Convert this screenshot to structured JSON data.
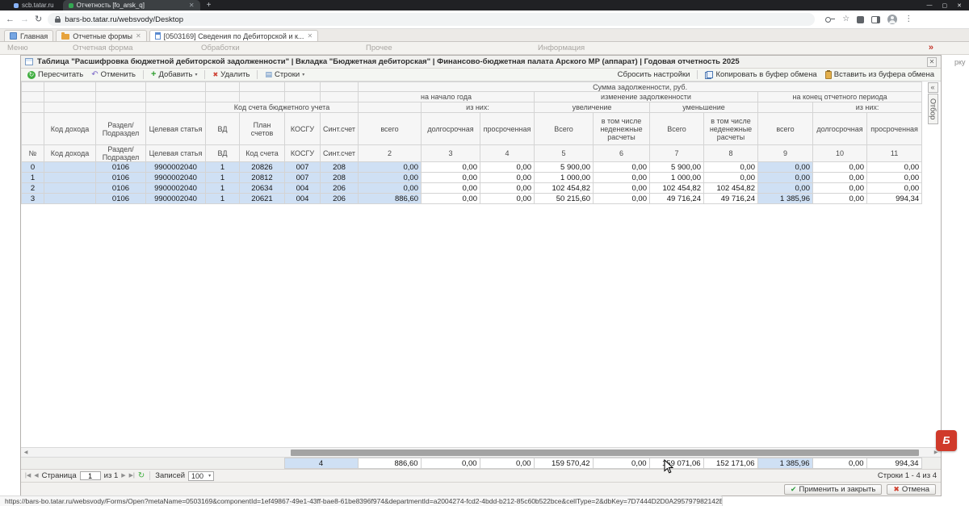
{
  "browser": {
    "tab1": "scb.tatar.ru",
    "tab2": "Отчетность [fo_arsk_q]",
    "url": "bars-bo.tatar.ru/websvody/Desktop",
    "status_url": "https://bars-bo.tatar.ru/websvody/Forms/Open?metaName=0503169&componentId=1ef49867-49e1-43ff-bae8-61be8396f974&departmentId=a2004274-fcd2-4bdd-b212-85c60b522bce&cellType=2&dbKey=7D7444D2D0A295797982142E24DCDAB3492A2DE32AD203F91DA73AD1F29AE97&actualDate=#"
  },
  "app_tabs": [
    {
      "label": "Главная"
    },
    {
      "label": "Отчетные формы"
    },
    {
      "label": "[0503169] Сведения по Дебиторской и к..."
    }
  ],
  "menu": {
    "items": [
      "Меню",
      "Отчетная форма",
      "Обработки",
      "Прочее",
      "Информация"
    ]
  },
  "artifact": "рку",
  "panel": {
    "title": "Таблица \"Расшифровка бюджетной дебиторской задолженности\" | Вкладка \"Бюджетная дебиторская\" | Финансово-бюджетная палата Арского МР (аппарат) | Годовая отчетность 2025"
  },
  "toolbar": {
    "recalc": "Пересчитать",
    "undo": "Отменить",
    "add": "Добавить",
    "delete": "Удалить",
    "rows": "Строки",
    "reset": "Сбросить настройки",
    "copy": "Копировать в буфер обмена",
    "paste": "Вставить из буфера обмена"
  },
  "filter_tab": "Отбор",
  "table": {
    "header": {
      "sum": "Сумма задолженности, руб.",
      "begin": "на начало года",
      "change": "изменение задолженности",
      "end": "на конец отчетного периода",
      "acct": "Код счета бюджетного учета",
      "ofthem": "из них:",
      "inc": "увеличение",
      "dec": "уменьшение",
      "income": "Код дохода",
      "section": "Раздел/ Подраздел",
      "target": "Целевая статья",
      "vd": "ВД",
      "plan": "План счетов",
      "kosgu": "КОСГУ",
      "synt": "Синт.счет",
      "total_l": "всего",
      "long": "долгосрочная",
      "overdue": "просроченная",
      "total_u": "Всего",
      "noncash": "в том числе неденежные расчеты"
    },
    "num_row": [
      "№",
      "Код дохода",
      "Раздел/ Подраздел",
      "Целевая статья",
      "ВД",
      "Код счета",
      "КОСГУ",
      "Синт.счет",
      "2",
      "3",
      "4",
      "5",
      "6",
      "7",
      "8",
      "9",
      "10",
      "11"
    ],
    "rows": [
      [
        "0",
        "",
        "0106",
        "9900002040",
        "1",
        "20826",
        "007",
        "208",
        "0,00",
        "0,00",
        "0,00",
        "5 900,00",
        "0,00",
        "5 900,00",
        "0,00",
        "0,00",
        "0,00",
        "0,00"
      ],
      [
        "1",
        "",
        "0106",
        "9900002040",
        "1",
        "20812",
        "007",
        "208",
        "0,00",
        "0,00",
        "0,00",
        "1 000,00",
        "0,00",
        "1 000,00",
        "0,00",
        "0,00",
        "0,00",
        "0,00"
      ],
      [
        "2",
        "",
        "0106",
        "9900002040",
        "1",
        "20634",
        "004",
        "206",
        "0,00",
        "0,00",
        "0,00",
        "102 454,82",
        "0,00",
        "102 454,82",
        "102 454,82",
        "0,00",
        "0,00",
        "0,00"
      ],
      [
        "3",
        "",
        "0106",
        "9900002040",
        "1",
        "20621",
        "004",
        "206",
        "886,60",
        "0,00",
        "0,00",
        "50 215,60",
        "0,00",
        "49 716,24",
        "49 716,24",
        "1 385,96",
        "0,00",
        "994,34"
      ]
    ],
    "footer": {
      "count": "4",
      "values": [
        "886,60",
        "0,00",
        "0,00",
        "159 570,42",
        "0,00",
        "159 071,06",
        "152 171,06",
        "1 385,96",
        "0,00",
        "994,34"
      ]
    }
  },
  "pager": {
    "page_label": "Страница",
    "page": "1",
    "page_of": "из 1",
    "records_label": "Записей",
    "records": "100",
    "rows_info": "Строки 1 - 4 из 4"
  },
  "actions": {
    "apply": "Применить и закрыть",
    "cancel": "Отмена"
  },
  "colors": {
    "selected_row": "#cfe0f4",
    "header_bg": "#f6f6f6",
    "apply_icon": "#2e9e3f",
    "cancel_icon": "#d0412f",
    "logo_red": "#d03a2b"
  }
}
